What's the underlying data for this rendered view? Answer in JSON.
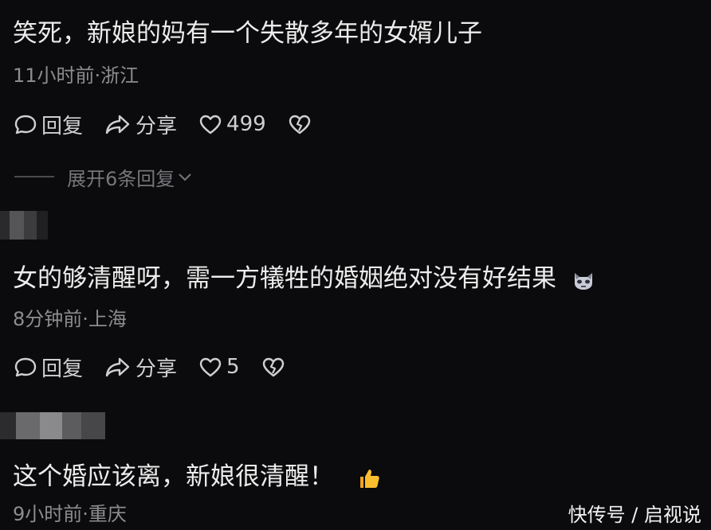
{
  "comments": [
    {
      "text": "笑死，新娘的妈有一个失散多年的女婿儿子",
      "meta": "11小时前·浙江",
      "reply_label": "回复",
      "share_label": "分享",
      "like_count": "499",
      "expand_label": "展开6条回复"
    },
    {
      "text": "女的够清醒呀，需一方犠牲的婚姻绝对没有好结果",
      "emoji": "cat-face-emoji",
      "meta": "8分钟前·上海",
      "reply_label": "回复",
      "share_label": "分享",
      "like_count": "5"
    },
    {
      "text": "这个婚应该离，新娘很清醒！",
      "emoji": "thumbs-up-emoji",
      "meta": "9小时前·重庆"
    }
  ],
  "watermark": "快传号 / 启视说",
  "colors": {
    "background": "#0b0b0d",
    "text": "#ececec",
    "meta": "#8d8d90",
    "action": "#d0d0d2"
  }
}
